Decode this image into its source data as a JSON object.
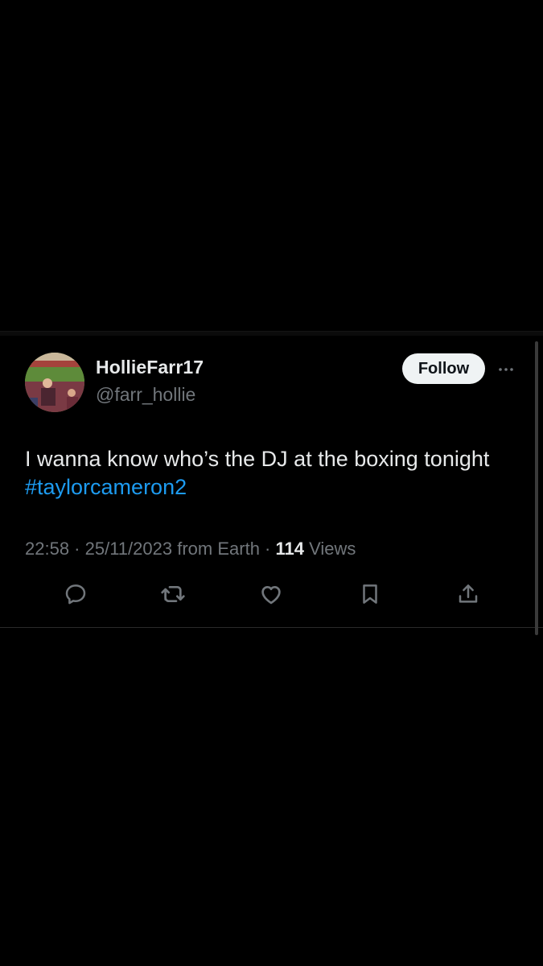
{
  "tweet": {
    "display_name": "HollieFarr17",
    "handle": "@farr_hollie",
    "follow_label": "Follow",
    "text": "I wanna know who’s the DJ at the boxing tonight",
    "hashtag": "#taylorcameron2",
    "time": "22:58",
    "separator": " · ",
    "date": "25/11/2023",
    "source": "from Earth",
    "views_count": "114",
    "views_label": "Views"
  },
  "icons": {
    "more": "more-icon",
    "reply": "reply-icon",
    "retweet": "retweet-icon",
    "like": "heart-icon",
    "bookmark": "bookmark-icon",
    "share": "share-icon"
  },
  "colors": {
    "background": "#000000",
    "text": "#e7e9ea",
    "secondary": "#71767b",
    "hashtag": "#1d9bf0",
    "follow_bg": "#eff3f4",
    "icon": "#71767b"
  }
}
